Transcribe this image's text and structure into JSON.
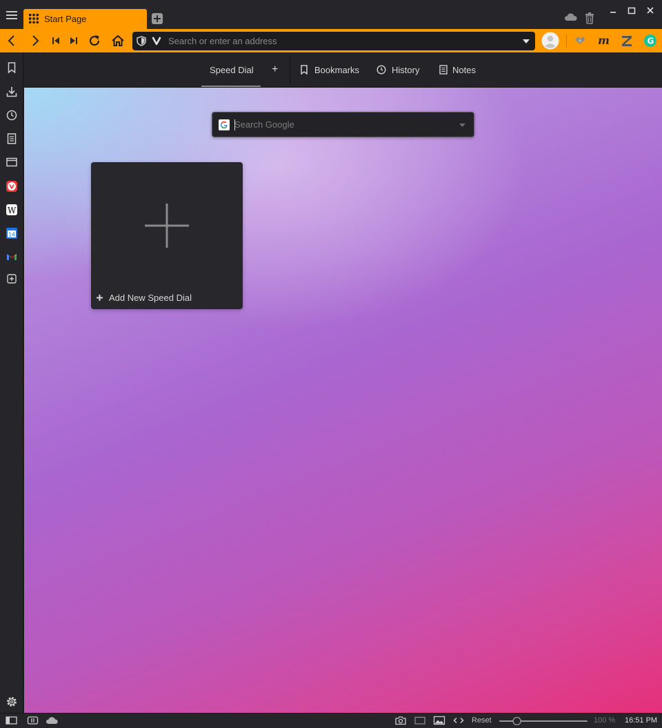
{
  "tabs": [
    {
      "title": "Start Page",
      "active": true
    }
  ],
  "address_bar": {
    "placeholder": "Search or enter an address",
    "value": ""
  },
  "start_page": {
    "nav": {
      "speed_dial": "Speed Dial",
      "add": "+",
      "bookmarks": "Bookmarks",
      "history": "History",
      "notes": "Notes"
    },
    "search": {
      "placeholder": "Search Google",
      "engine": "Google"
    },
    "tiles": [
      {
        "label": "Add New Speed Dial",
        "icon": "plus-icon"
      }
    ]
  },
  "sidebar_icons": [
    "bookmarks-icon",
    "downloads-icon",
    "history-icon",
    "notes-icon",
    "window-icon",
    "vivaldi-icon",
    "wikipedia-icon",
    "calendar-icon",
    "gmail-icon",
    "add-web-panel-icon"
  ],
  "calendar_day": "14",
  "extensions": [
    "profile-icon",
    "extension-icon",
    "m-extension-icon",
    "zotero-icon",
    "grammarly-icon"
  ],
  "status_bar": {
    "reset_label": "Reset",
    "zoom": "100 %",
    "zoom_level": 0.2,
    "clock": "16:51 PM"
  },
  "colors": {
    "accent": "#ff9a00",
    "chrome": "#26262a",
    "tile_bg": "#28282c"
  }
}
